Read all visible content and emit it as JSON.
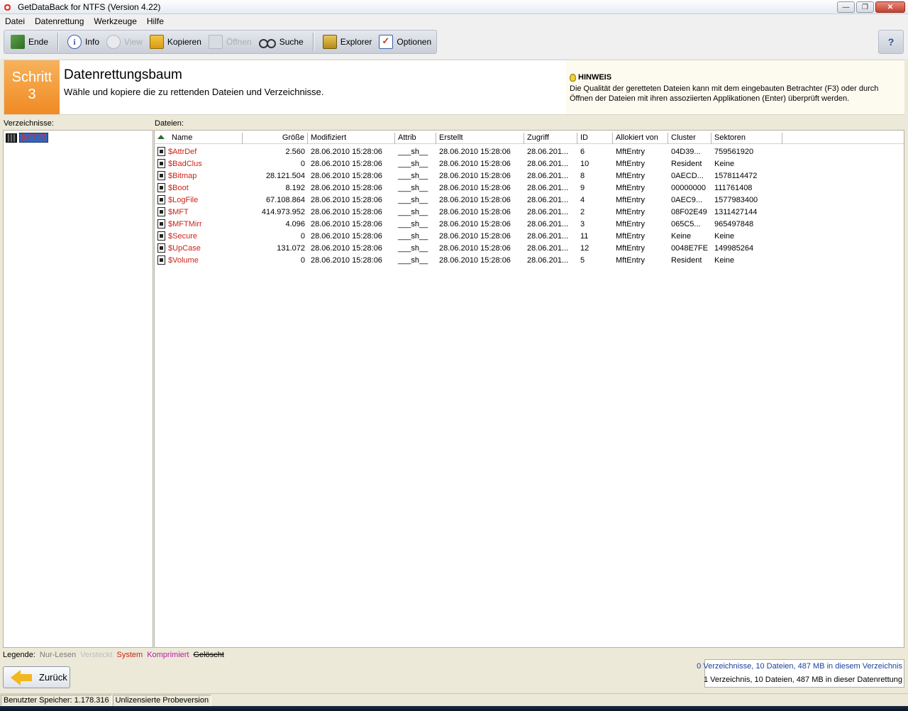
{
  "window": {
    "title": "GetDataBack for NTFS (Version 4.22)",
    "min": "—",
    "max": "❐",
    "close": "✕"
  },
  "menu": [
    "Datei",
    "Datenrettung",
    "Werkzeuge",
    "Hilfe"
  ],
  "toolbar": {
    "exit": "Ende",
    "info": "Info",
    "view": "View",
    "copy": "Kopieren",
    "open": "Öffnen",
    "search": "Suche",
    "explorer": "Explorer",
    "options": "Optionen",
    "help": "?"
  },
  "step": {
    "label": "Schritt",
    "number": "3",
    "title": "Datenrettungsbaum",
    "subtitle": "Wähle und kopiere die zu rettenden Dateien und Verzeichnisse."
  },
  "hint": {
    "title": "HINWEIS",
    "body": "Die Qualität der geretteten Dateien kann mit dem eingebauten Betrachter (F3) oder durch Öffnen der Dateien mit ihren assoziierten Applikationen (Enter) überprüft werden."
  },
  "directories": {
    "label": "Verzeichnisse:",
    "root": "[NTFS]"
  },
  "files": {
    "label": "Dateien:",
    "columns": [
      "Name",
      "Größe",
      "Modifiziert",
      "Attrib",
      "Erstellt",
      "Zugriff",
      "ID",
      "Allokiert von",
      "Cluster",
      "Sektoren"
    ],
    "rows": [
      [
        "$AttrDef",
        "2.560",
        "28.06.2010 15:28:06",
        "___sh__",
        "28.06.2010 15:28:06",
        "28.06.201...",
        "6",
        "MftEntry",
        "04D39...",
        "759561920"
      ],
      [
        "$BadClus",
        "0",
        "28.06.2010 15:28:06",
        "___sh__",
        "28.06.2010 15:28:06",
        "28.06.201...",
        "10",
        "MftEntry",
        "Resident",
        "Keine"
      ],
      [
        "$Bitmap",
        "28.121.504",
        "28.06.2010 15:28:06",
        "___sh__",
        "28.06.2010 15:28:06",
        "28.06.201...",
        "8",
        "MftEntry",
        "0AECD...",
        "1578114472"
      ],
      [
        "$Boot",
        "8.192",
        "28.06.2010 15:28:06",
        "___sh__",
        "28.06.2010 15:28:06",
        "28.06.201...",
        "9",
        "MftEntry",
        "00000000",
        "111761408"
      ],
      [
        "$LogFile",
        "67.108.864",
        "28.06.2010 15:28:06",
        "___sh__",
        "28.06.2010 15:28:06",
        "28.06.201...",
        "4",
        "MftEntry",
        "0AEC9...",
        "1577983400"
      ],
      [
        "$MFT",
        "414.973.952",
        "28.06.2010 15:28:06",
        "___sh__",
        "28.06.2010 15:28:06",
        "28.06.201...",
        "2",
        "MftEntry",
        "08F02E49",
        "1311427144"
      ],
      [
        "$MFTMirr",
        "4.096",
        "28.06.2010 15:28:06",
        "___sh__",
        "28.06.2010 15:28:06",
        "28.06.201...",
        "3",
        "MftEntry",
        "065C5...",
        "965497848"
      ],
      [
        "$Secure",
        "0",
        "28.06.2010 15:28:06",
        "___sh__",
        "28.06.2010 15:28:06",
        "28.06.201...",
        "11",
        "MftEntry",
        "Keine",
        "Keine"
      ],
      [
        "$UpCase",
        "131.072",
        "28.06.2010 15:28:06",
        "___sh__",
        "28.06.2010 15:28:06",
        "28.06.201...",
        "12",
        "MftEntry",
        "0048E7FE",
        "149985264"
      ],
      [
        "$Volume",
        "0",
        "28.06.2010 15:28:06",
        "___sh__",
        "28.06.2010 15:28:06",
        "28.06.201...",
        "5",
        "MftEntry",
        "Resident",
        "Keine"
      ]
    ]
  },
  "legend": {
    "label": "Legende:",
    "readonly": "Nur-Lesen",
    "hidden": "Versteckt",
    "system": "System",
    "compressed": "Komprimiert",
    "deleted": "Gelöscht"
  },
  "back_button": "Zurück",
  "stats": {
    "line1": "0 Verzeichnisse, 10 Dateien, 487 MB in diesem Verzeichnis",
    "line2": "1 Verzeichnis, 10 Dateien, 487 MB in dieser Datenrettung"
  },
  "statusbar": {
    "memory": "Benutzter Speicher: 1.178.316",
    "license": "Unlizensierte Probeversion"
  },
  "colors": {
    "step_orange": "#f08a24",
    "system_red": "#c92418",
    "selection_blue": "#3166c4"
  }
}
